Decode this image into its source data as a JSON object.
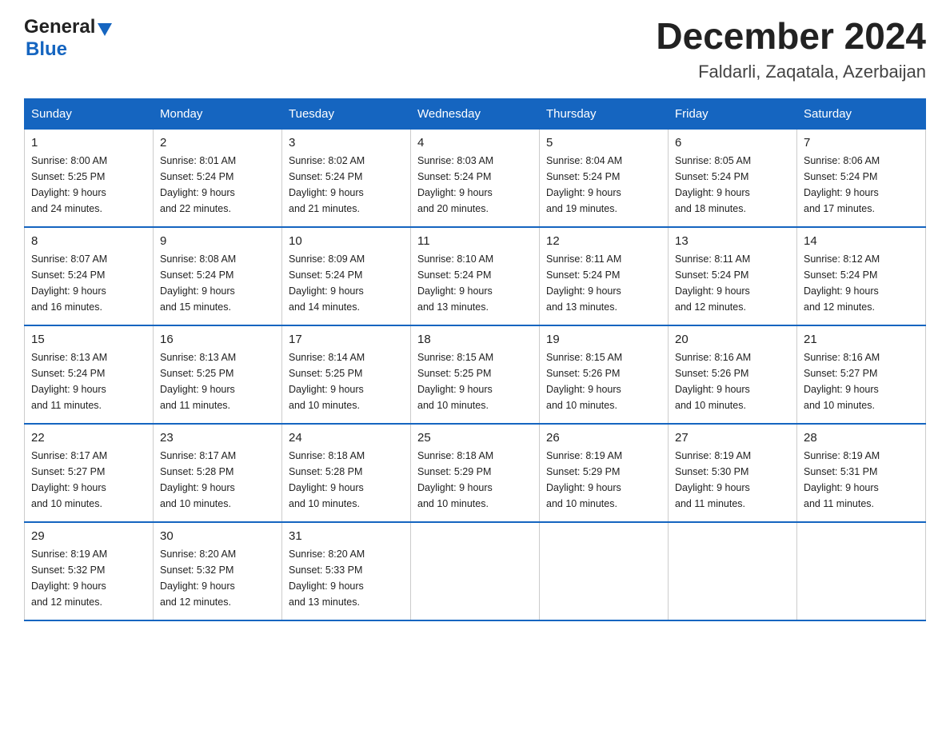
{
  "header": {
    "logo_general": "General",
    "logo_blue": "Blue",
    "title": "December 2024",
    "subtitle": "Faldarli, Zaqatala, Azerbaijan"
  },
  "days_of_week": [
    "Sunday",
    "Monday",
    "Tuesday",
    "Wednesday",
    "Thursday",
    "Friday",
    "Saturday"
  ],
  "weeks": [
    [
      {
        "day": "1",
        "sunrise": "8:00 AM",
        "sunset": "5:25 PM",
        "daylight": "9 hours and 24 minutes."
      },
      {
        "day": "2",
        "sunrise": "8:01 AM",
        "sunset": "5:24 PM",
        "daylight": "9 hours and 22 minutes."
      },
      {
        "day": "3",
        "sunrise": "8:02 AM",
        "sunset": "5:24 PM",
        "daylight": "9 hours and 21 minutes."
      },
      {
        "day": "4",
        "sunrise": "8:03 AM",
        "sunset": "5:24 PM",
        "daylight": "9 hours and 20 minutes."
      },
      {
        "day": "5",
        "sunrise": "8:04 AM",
        "sunset": "5:24 PM",
        "daylight": "9 hours and 19 minutes."
      },
      {
        "day": "6",
        "sunrise": "8:05 AM",
        "sunset": "5:24 PM",
        "daylight": "9 hours and 18 minutes."
      },
      {
        "day": "7",
        "sunrise": "8:06 AM",
        "sunset": "5:24 PM",
        "daylight": "9 hours and 17 minutes."
      }
    ],
    [
      {
        "day": "8",
        "sunrise": "8:07 AM",
        "sunset": "5:24 PM",
        "daylight": "9 hours and 16 minutes."
      },
      {
        "day": "9",
        "sunrise": "8:08 AM",
        "sunset": "5:24 PM",
        "daylight": "9 hours and 15 minutes."
      },
      {
        "day": "10",
        "sunrise": "8:09 AM",
        "sunset": "5:24 PM",
        "daylight": "9 hours and 14 minutes."
      },
      {
        "day": "11",
        "sunrise": "8:10 AM",
        "sunset": "5:24 PM",
        "daylight": "9 hours and 13 minutes."
      },
      {
        "day": "12",
        "sunrise": "8:11 AM",
        "sunset": "5:24 PM",
        "daylight": "9 hours and 13 minutes."
      },
      {
        "day": "13",
        "sunrise": "8:11 AM",
        "sunset": "5:24 PM",
        "daylight": "9 hours and 12 minutes."
      },
      {
        "day": "14",
        "sunrise": "8:12 AM",
        "sunset": "5:24 PM",
        "daylight": "9 hours and 12 minutes."
      }
    ],
    [
      {
        "day": "15",
        "sunrise": "8:13 AM",
        "sunset": "5:24 PM",
        "daylight": "9 hours and 11 minutes."
      },
      {
        "day": "16",
        "sunrise": "8:13 AM",
        "sunset": "5:25 PM",
        "daylight": "9 hours and 11 minutes."
      },
      {
        "day": "17",
        "sunrise": "8:14 AM",
        "sunset": "5:25 PM",
        "daylight": "9 hours and 10 minutes."
      },
      {
        "day": "18",
        "sunrise": "8:15 AM",
        "sunset": "5:25 PM",
        "daylight": "9 hours and 10 minutes."
      },
      {
        "day": "19",
        "sunrise": "8:15 AM",
        "sunset": "5:26 PM",
        "daylight": "9 hours and 10 minutes."
      },
      {
        "day": "20",
        "sunrise": "8:16 AM",
        "sunset": "5:26 PM",
        "daylight": "9 hours and 10 minutes."
      },
      {
        "day": "21",
        "sunrise": "8:16 AM",
        "sunset": "5:27 PM",
        "daylight": "9 hours and 10 minutes."
      }
    ],
    [
      {
        "day": "22",
        "sunrise": "8:17 AM",
        "sunset": "5:27 PM",
        "daylight": "9 hours and 10 minutes."
      },
      {
        "day": "23",
        "sunrise": "8:17 AM",
        "sunset": "5:28 PM",
        "daylight": "9 hours and 10 minutes."
      },
      {
        "day": "24",
        "sunrise": "8:18 AM",
        "sunset": "5:28 PM",
        "daylight": "9 hours and 10 minutes."
      },
      {
        "day": "25",
        "sunrise": "8:18 AM",
        "sunset": "5:29 PM",
        "daylight": "9 hours and 10 minutes."
      },
      {
        "day": "26",
        "sunrise": "8:19 AM",
        "sunset": "5:29 PM",
        "daylight": "9 hours and 10 minutes."
      },
      {
        "day": "27",
        "sunrise": "8:19 AM",
        "sunset": "5:30 PM",
        "daylight": "9 hours and 11 minutes."
      },
      {
        "day": "28",
        "sunrise": "8:19 AM",
        "sunset": "5:31 PM",
        "daylight": "9 hours and 11 minutes."
      }
    ],
    [
      {
        "day": "29",
        "sunrise": "8:19 AM",
        "sunset": "5:32 PM",
        "daylight": "9 hours and 12 minutes."
      },
      {
        "day": "30",
        "sunrise": "8:20 AM",
        "sunset": "5:32 PM",
        "daylight": "9 hours and 12 minutes."
      },
      {
        "day": "31",
        "sunrise": "8:20 AM",
        "sunset": "5:33 PM",
        "daylight": "9 hours and 13 minutes."
      },
      null,
      null,
      null,
      null
    ]
  ],
  "labels": {
    "sunrise": "Sunrise:",
    "sunset": "Sunset:",
    "daylight": "Daylight:"
  }
}
